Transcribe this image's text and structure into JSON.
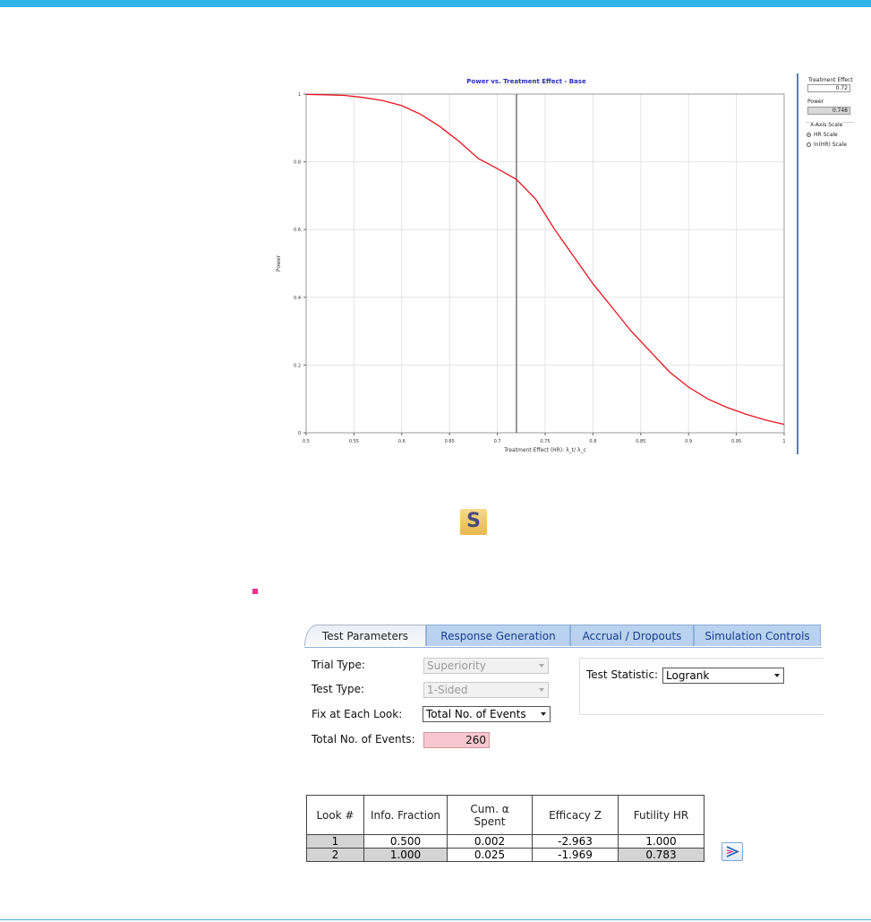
{
  "chart_data": {
    "type": "line",
    "title": "Power vs. Treatment Effect - Base",
    "xlabel": "Treatment Effect (HR): λ_t/ λ_c",
    "ylabel": "Power",
    "xlim": [
      0.5,
      1.0
    ],
    "ylim": [
      0,
      1
    ],
    "xticks": [
      "0.5",
      "0.55",
      "0.6",
      "0.65",
      "0.7",
      "0.75",
      "0.8",
      "0.85",
      "0.9",
      "0.95",
      "1"
    ],
    "yticks": [
      "0",
      "0.2",
      "0.4",
      "0.6",
      "0.8",
      "1"
    ],
    "grid": true,
    "reference_line_x": 0.72,
    "series_color": "#e8141e",
    "series": [
      {
        "x": [
          0.5,
          0.52,
          0.54,
          0.56,
          0.58,
          0.6,
          0.62,
          0.64,
          0.66,
          0.68,
          0.7,
          0.72,
          0.74,
          0.76,
          0.78,
          0.8,
          0.82,
          0.84,
          0.86,
          0.88,
          0.9,
          0.92,
          0.94,
          0.96,
          0.98,
          1.0
        ],
        "y": [
          0.999,
          0.998,
          0.996,
          0.99,
          0.981,
          0.966,
          0.94,
          0.904,
          0.86,
          0.81,
          0.78,
          0.748,
          0.69,
          0.6,
          0.52,
          0.44,
          0.37,
          0.3,
          0.24,
          0.18,
          0.135,
          0.1,
          0.075,
          0.055,
          0.038,
          0.025
        ]
      }
    ]
  },
  "side_panel": {
    "treatment_effect_label": "Treatment Effect",
    "treatment_effect_value": "0.72",
    "power_label": "Power",
    "power_value": "0.748",
    "xaxis_scale_label": "X-Axis Scale",
    "hr_scale_label": "HR Scale",
    "lnhr_scale_label": "ln(HR) Scale",
    "selected_scale": "HR Scale"
  },
  "s_icon": {
    "letter": "S"
  },
  "tabs": [
    {
      "label": "Test Parameters",
      "active": true
    },
    {
      "label": "Response Generation",
      "active": false
    },
    {
      "label": "Accrual / Dropouts",
      "active": false
    },
    {
      "label": "Simulation Controls",
      "active": false
    }
  ],
  "form": {
    "trial_type_label": "Trial Type:",
    "trial_type_value": "Superiority",
    "test_type_label": "Test Type:",
    "test_type_value": "1-Sided",
    "fix_label": "Fix at Each Look:",
    "fix_value": "Total No. of Events",
    "total_events_label": "Total No. of Events:",
    "total_events_value": "260",
    "test_statistic_label": "Test Statistic:",
    "test_statistic_value": "Logrank"
  },
  "looks_table": {
    "headers": [
      "Look #",
      "Info. Fraction",
      "Cum. α Spent",
      "Efficacy Z",
      "Futility HR"
    ],
    "header_line1": [
      "Look #",
      "Info. Fraction",
      "Cum. α",
      "Efficacy Z",
      "Futility HR"
    ],
    "header_line2": [
      "",
      "",
      "Spent",
      "",
      ""
    ],
    "rows": [
      [
        "1",
        "0.500",
        "0.002",
        "-2.963",
        "1.000"
      ],
      [
        "2",
        "1.000",
        "0.025",
        "-1.969",
        "0.783"
      ]
    ]
  },
  "colors": {
    "top_bar": "#2fb5e8",
    "curve": "#e8141e",
    "input_highlight": "#f7c6cf",
    "tab_inactive": "#b9d2f0"
  },
  "icons": [
    "s-logo-icon",
    "export-chart-icon",
    "dropdown-arrow-icon"
  ]
}
